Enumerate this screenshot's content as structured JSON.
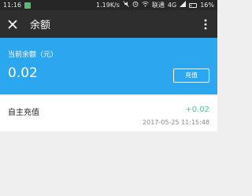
{
  "status_bar": {
    "time": "11:16",
    "speed": "1.19K/s",
    "carrier": "联通",
    "network": "4G",
    "battery": "16%"
  },
  "app_bar": {
    "title": "余额"
  },
  "balance": {
    "label": "当前余额（元）",
    "value": "0.02",
    "recharge_label": "充值"
  },
  "records": [
    {
      "title": "自主充值",
      "amount": "+0.02",
      "time": "2017-05-25 11:15:48"
    }
  ],
  "colors": {
    "app_bar": "#2e2e2e",
    "balance_card": "#2aa7ee",
    "amount_positive": "#4ec9a0"
  }
}
